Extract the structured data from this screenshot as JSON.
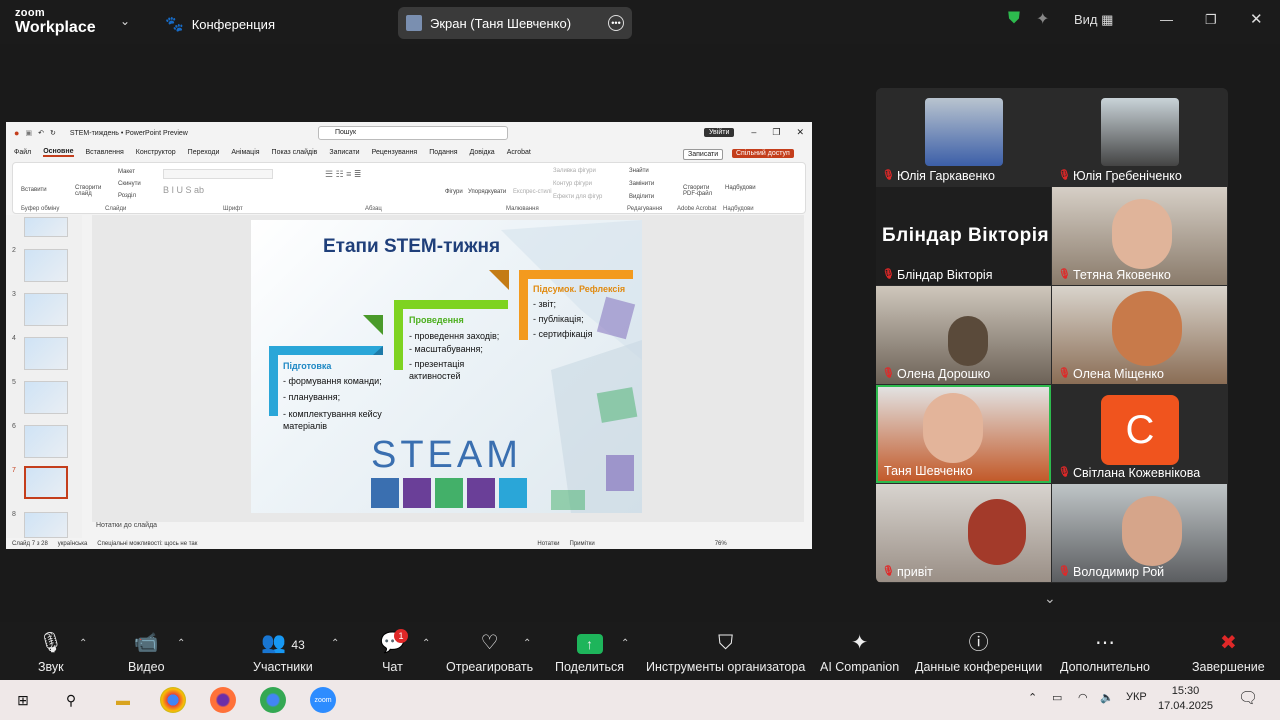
{
  "app": {
    "logo_top": "zoom",
    "logo_bottom": "Workplace",
    "conference_label": "Конференция",
    "screen_share_label": "Экран (Таня Шевченко)",
    "view_label": "Вид"
  },
  "ppt": {
    "title": "STEM-тиждень • PowerPoint Preview",
    "search_placeholder": "Пошук",
    "signin": "Увійти",
    "menu": [
      "Файл",
      "Основне",
      "Вставлення",
      "Конструктор",
      "Переходи",
      "Анімація",
      "Показ слайдів",
      "Записати",
      "Рецензування",
      "Подання",
      "Довідка",
      "Acrobat"
    ],
    "write_btn": "Записати",
    "share_btn": "Спільний доступ",
    "ribbon_groups": [
      "Буфер обміну",
      "Слайди",
      "Шрифт",
      "Абзац",
      "Малювання",
      "Редагування",
      "Adobe Acrobat",
      "Надбудови"
    ],
    "ribbon_items": {
      "paste": "Вставити",
      "create": "Створити слайд",
      "layout": "Макет",
      "reset": "Скинути",
      "sections": "Розділ",
      "shapes": "Фігури",
      "arrange": "Упорядкувати",
      "styles": "Експрес-стилі",
      "fill": "Заливка фігури",
      "outline": "Контур фігури",
      "effects": "Ефекти для фігур",
      "find": "Знайти",
      "replace": "Замінити",
      "select": "Виділити",
      "pdf": "Створити PDF-файл",
      "addins": "Надбудови"
    },
    "thumb_numbers": [
      "2",
      "3",
      "4",
      "5",
      "6",
      "7",
      "8"
    ],
    "notes": "Нотатки до слайда",
    "status": {
      "slide": "Слайд 7 з 28",
      "lang": "українська",
      "access": "Спеціальні можливості: щось не так",
      "notes": "Нотатки",
      "comments": "Примітки",
      "zoom": "76%"
    }
  },
  "slide": {
    "title": "Етапи  STEM-тижня",
    "stage1": {
      "head": "Підготовка",
      "items": [
        "- формування команди;",
        "- планування;",
        "- комплектування кейсу  матеріалів"
      ]
    },
    "stage2": {
      "head": "Проведення",
      "items": [
        "- проведення заходів;",
        "- масштабування;",
        "-  презентація активностей"
      ]
    },
    "stage3": {
      "head": "Підсумок. Рефлексія",
      "items": [
        "- звіт;",
        "- публікація;",
        "- сертифікація"
      ]
    },
    "steam": "STEAM",
    "colors": {
      "blue": "#2aa6d8",
      "green": "#7ed321",
      "orange": "#f39a1e",
      "title": "#1f3f7a"
    }
  },
  "participants": [
    {
      "name": "Юлія Гаркавенко",
      "muted": true
    },
    {
      "name": "Юлія Гребеніченко",
      "muted": true
    },
    {
      "name": "Блiндар Вiкторiя",
      "muted": true,
      "big": "Блiндар Вiкторiя"
    },
    {
      "name": "Тетяна Яковенко",
      "muted": true
    },
    {
      "name": "Олена Дорошко",
      "muted": true
    },
    {
      "name": "Олена Міщенко",
      "muted": true
    },
    {
      "name": "Таня Шевченко",
      "muted": false
    },
    {
      "name": "Світлана Кожевнікова",
      "muted": true,
      "avatar": "C"
    },
    {
      "name": "привіт",
      "muted": true
    },
    {
      "name": "Володимир Рой",
      "muted": true
    }
  ],
  "toolbar": {
    "audio": "Звук",
    "video": "Видео",
    "participants": "Участники",
    "participants_count": "43",
    "chat": "Чат",
    "chat_badge": "1",
    "react": "Отреагировать",
    "share": "Поделиться",
    "host_tools": "Инструменты организатора",
    "ai": "AI Companion",
    "info": "Данные конференции",
    "more": "Дополнительно",
    "end": "Завершение"
  },
  "taskbar": {
    "lang": "УКР",
    "time": "15:30",
    "date": "17.04.2025",
    "zoom_label": "zoom"
  }
}
